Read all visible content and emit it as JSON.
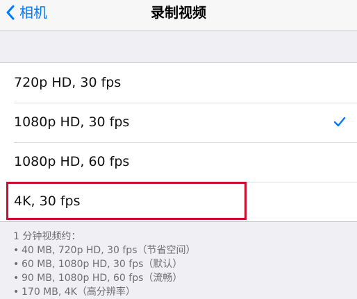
{
  "nav": {
    "back_label": "相机",
    "title": "录制视频"
  },
  "options": [
    {
      "label": "720p HD, 30 fps",
      "selected": false
    },
    {
      "label": "1080p HD, 30 fps",
      "selected": true
    },
    {
      "label": "1080p HD, 60 fps",
      "selected": false
    },
    {
      "label": "4K, 30 fps",
      "selected": false
    }
  ],
  "footer": {
    "heading": "1 分钟视频约：",
    "items": [
      "40 MB, 720p HD, 30 fps（节省空间）",
      "60 MB, 1080p HD, 30 fps（默认）",
      "90 MB, 1080p HD, 60 fps（流畅）",
      "170 MB, 4K（高分辨率）"
    ]
  },
  "colors": {
    "accent": "#007aff",
    "highlight": "#c8102e",
    "background": "#efeff4"
  },
  "icons": {
    "back": "chevron-left-icon",
    "selected": "checkmark-icon"
  }
}
